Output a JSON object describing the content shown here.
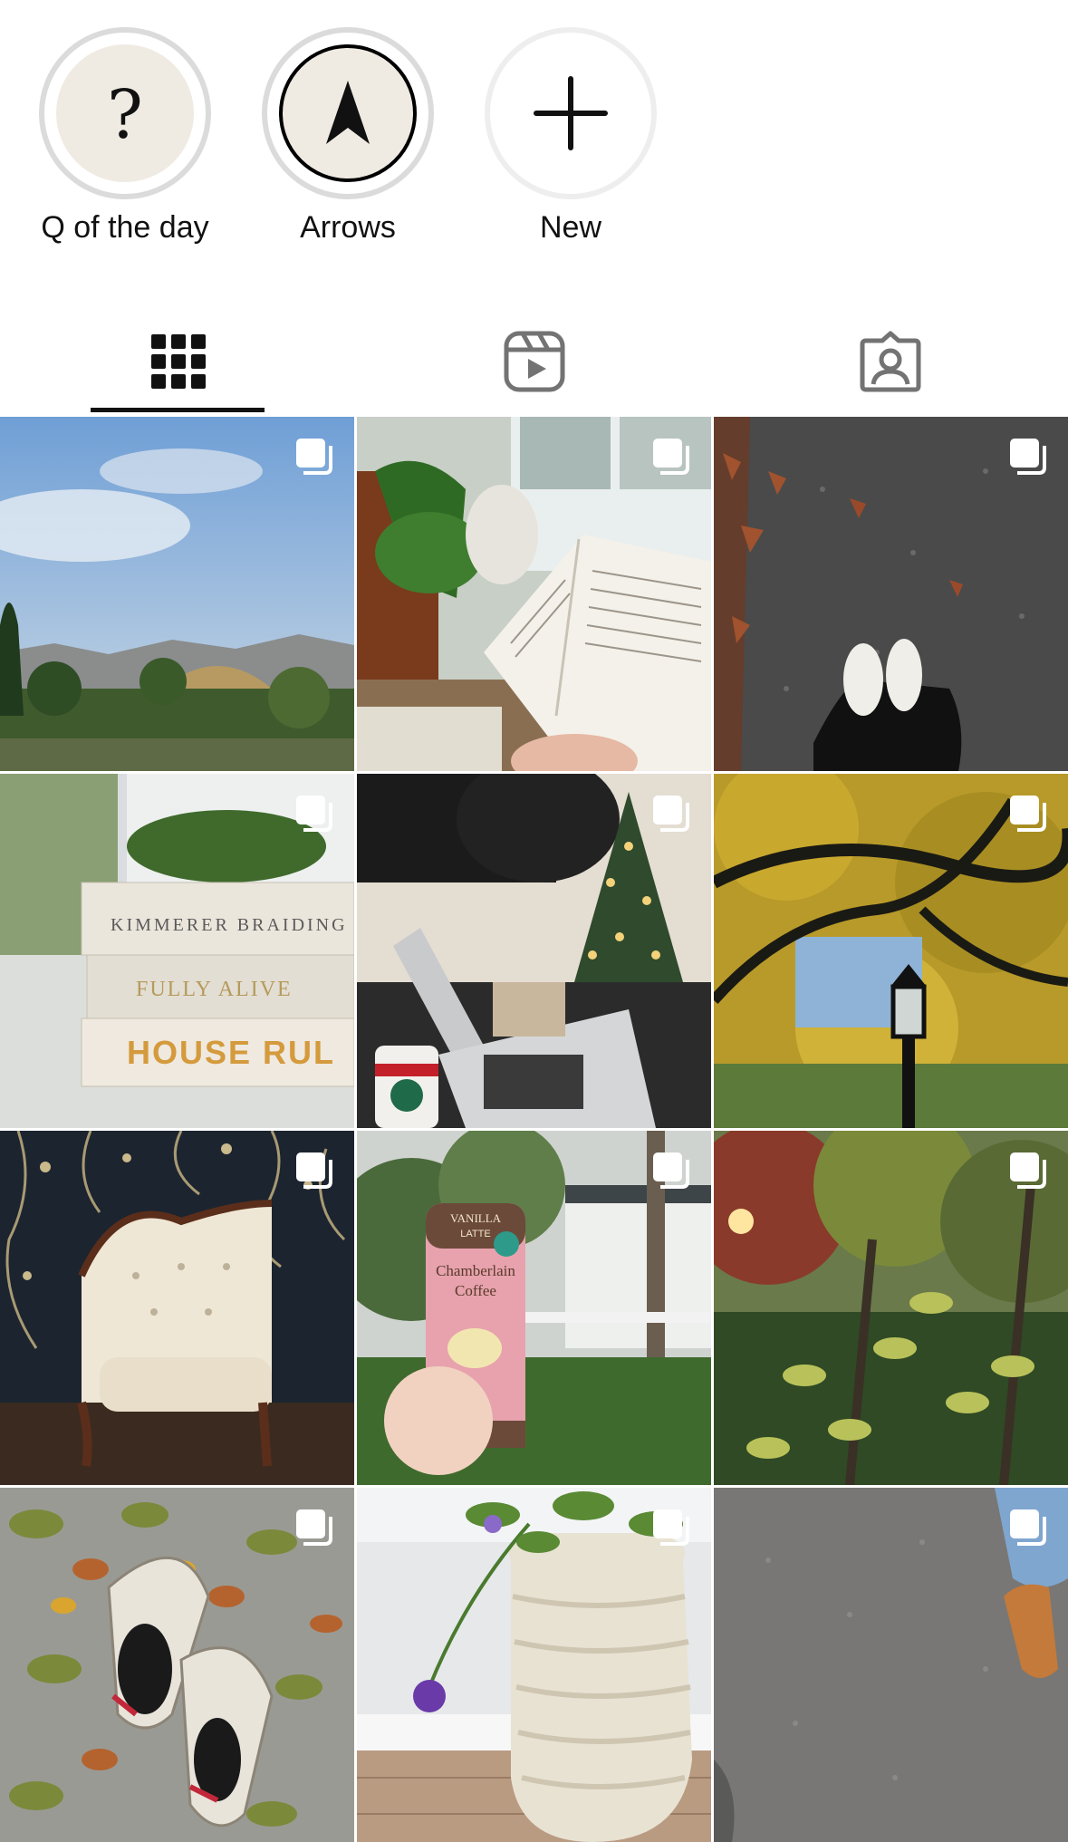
{
  "highlights": [
    {
      "label": "Q of the day",
      "icon": "question-mark-icon",
      "glyph": "?"
    },
    {
      "label": "Arrows",
      "icon": "arrow-up-icon"
    },
    {
      "label": "New",
      "icon": "plus-icon"
    }
  ],
  "tabs": [
    {
      "name": "posts",
      "icon": "grid-icon",
      "active": true
    },
    {
      "name": "reels",
      "icon": "reels-icon",
      "active": false
    },
    {
      "name": "tagged",
      "icon": "tagged-user-icon",
      "active": false
    }
  ],
  "grid": {
    "columns": 3,
    "posts": [
      {
        "subject": "hollywood-hills-sky",
        "multi": true
      },
      {
        "subject": "reading-book-plant",
        "multi": true
      },
      {
        "subject": "sneakers-on-asphalt",
        "multi": true
      },
      {
        "subject": "stacked-books",
        "multi": true
      },
      {
        "subject": "laptop-christmas-tree",
        "multi": true
      },
      {
        "subject": "tree-lamp-post",
        "multi": true
      },
      {
        "subject": "tufted-chair",
        "multi": true
      },
      {
        "subject": "canned-coffee",
        "multi": true
      },
      {
        "subject": "autumn-garden",
        "multi": true
      },
      {
        "subject": "sneakers-on-leaves",
        "multi": true
      },
      {
        "subject": "flower-vase",
        "multi": true
      },
      {
        "subject": "pavement-feet",
        "multi": true
      }
    ]
  },
  "photo_text": {
    "books": [
      "KIMMERER  BRAIDING",
      "FULLY ALIVE",
      "HOUSE RUL"
    ],
    "can": [
      "VANILLA",
      "LATTE",
      "Chamberlain",
      "Coffee"
    ]
  },
  "colors": {
    "text": "#111111",
    "ring": "#dbdbdb",
    "highlight_fill": "#efebe3",
    "inactive_icon": "#737373"
  }
}
